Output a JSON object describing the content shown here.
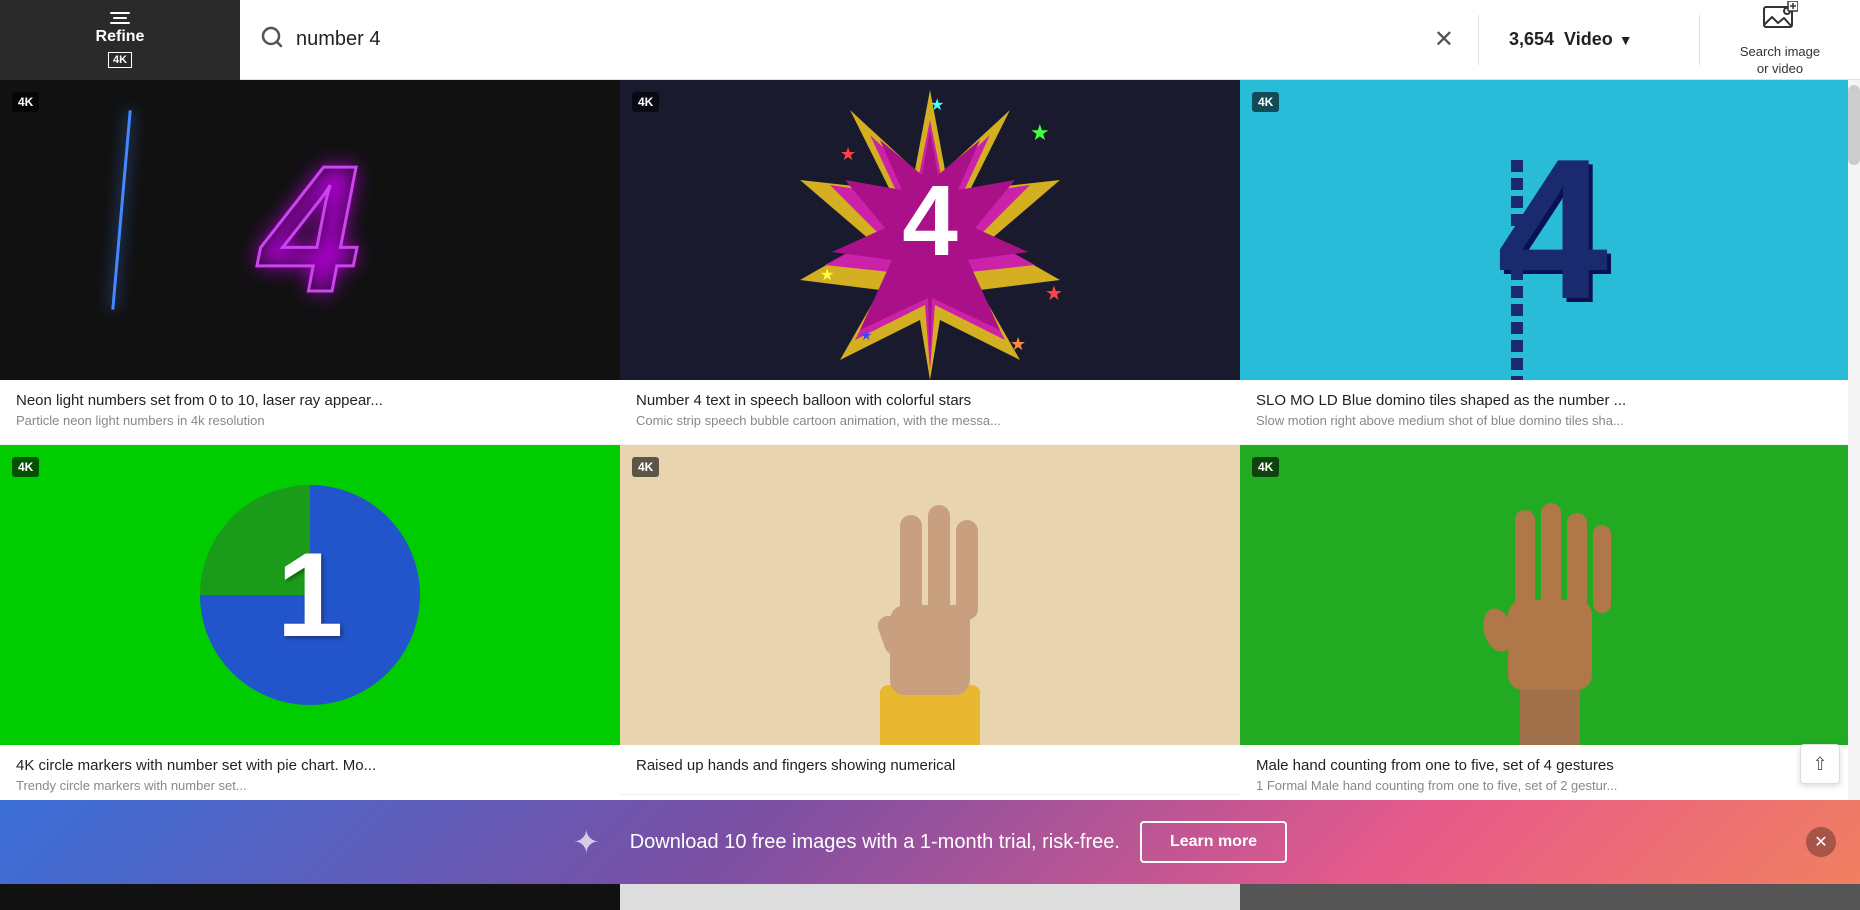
{
  "header": {
    "refine_label": "Refine",
    "refine_4k": "4K",
    "search_placeholder": "number 4",
    "result_count": "3,654",
    "video_label": "Video",
    "search_image_label": "Search image\nor video"
  },
  "grid": {
    "cards": [
      {
        "id": 1,
        "has_4k": true,
        "title": "Neon light numbers set from 0 to 10, laser ray appear...",
        "subtitle": "Particle neon light numbers in 4k resolution",
        "thumb_type": "neon"
      },
      {
        "id": 2,
        "has_4k": true,
        "title": "Number 4 text in speech balloon with colorful stars",
        "subtitle": "Comic strip speech bubble cartoon animation, with the messa...",
        "thumb_type": "starburst"
      },
      {
        "id": 3,
        "has_4k": true,
        "title": "SLO MO LD Blue domino tiles shaped as the number ...",
        "subtitle": "Slow motion right above medium shot of blue domino tiles sha...",
        "thumb_type": "domino"
      },
      {
        "id": 4,
        "has_4k": true,
        "title": "4K circle markers with number set with pie chart. Mo...",
        "subtitle": "Trendy circle markers with number set...",
        "thumb_type": "pie"
      },
      {
        "id": 5,
        "has_4k": true,
        "title": "Raised up hands and fingers showing numerical",
        "subtitle": "",
        "thumb_type": "hand-raised"
      },
      {
        "id": 6,
        "has_4k": true,
        "title": "Male hand counting from one to five, set of 4 gestures",
        "subtitle": "1 Formal Male hand counting from one to five, set of 2 gestur...",
        "thumb_type": "hand-green"
      }
    ]
  },
  "promo": {
    "text": "Download 10 free images with a 1-month trial, risk-free.",
    "learn_more_label": "Learn more"
  },
  "badge": {
    "label": "4K"
  }
}
